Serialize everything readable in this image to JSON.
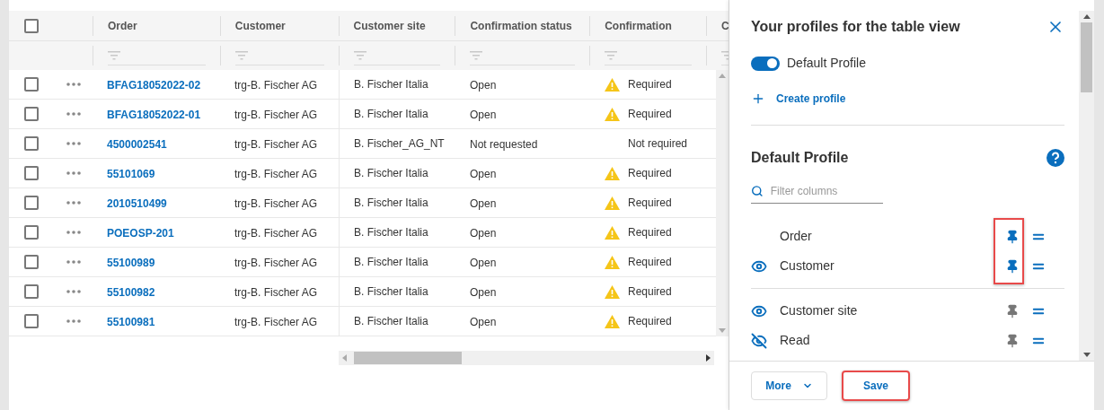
{
  "table": {
    "select_all_checked": false,
    "columns": [
      "Order",
      "Customer",
      "Customer site",
      "Confirmation status",
      "Confirmation",
      "C"
    ],
    "rows": [
      {
        "order": "BFAG18052022-02",
        "customer": "trg-B. Fischer AG",
        "site": "B. Fischer Italia",
        "status": "Open",
        "confirmation": "Required",
        "warning": true,
        "checked": false
      },
      {
        "order": "BFAG18052022-01",
        "customer": "trg-B. Fischer AG",
        "site": "B. Fischer Italia",
        "status": "Open",
        "confirmation": "Required",
        "warning": true,
        "checked": false
      },
      {
        "order": "4500002541",
        "customer": "trg-B. Fischer AG",
        "site": "B. Fischer_AG_NT",
        "status": "Not requested",
        "confirmation": "Not required",
        "warning": false,
        "checked": false
      },
      {
        "order": "55101069",
        "customer": "trg-B. Fischer AG",
        "site": "B. Fischer Italia",
        "status": "Open",
        "confirmation": "Required",
        "warning": true,
        "checked": false
      },
      {
        "order": "2010510499",
        "customer": "trg-B. Fischer AG",
        "site": "B. Fischer Italia",
        "status": "Open",
        "confirmation": "Required",
        "warning": true,
        "checked": false
      },
      {
        "order": "POEOSP-201",
        "customer": "trg-B. Fischer AG",
        "site": "B. Fischer Italia",
        "status": "Open",
        "confirmation": "Required",
        "warning": true,
        "checked": false
      },
      {
        "order": "55100989",
        "customer": "trg-B. Fischer AG",
        "site": "B. Fischer Italia",
        "status": "Open",
        "confirmation": "Required",
        "warning": true,
        "checked": false
      },
      {
        "order": "55100982",
        "customer": "trg-B. Fischer AG",
        "site": "B. Fischer Italia",
        "status": "Open",
        "confirmation": "Required",
        "warning": true,
        "checked": false
      },
      {
        "order": "55100981",
        "customer": "trg-B. Fischer AG",
        "site": "B. Fischer Italia",
        "status": "Open",
        "confirmation": "Required",
        "warning": true,
        "checked": false
      }
    ]
  },
  "panel": {
    "title": "Your profiles for the table view",
    "toggle": {
      "label": "Default Profile",
      "on": true
    },
    "create": "Create profile",
    "profile_title": "Default Profile",
    "filter": {
      "placeholder": "Filter columns"
    },
    "pinned_columns": [
      {
        "label": "Order",
        "pinned": true
      },
      {
        "label": "Customer",
        "visible": true,
        "pinned": true
      }
    ],
    "pins_highlighted": true,
    "other_columns": [
      {
        "label": "Customer site",
        "visible": true,
        "pinned": false
      },
      {
        "label": "Read",
        "visible": false,
        "pinned": false
      }
    ],
    "more": "More",
    "save": {
      "label": "Save",
      "highlighted": true
    }
  }
}
